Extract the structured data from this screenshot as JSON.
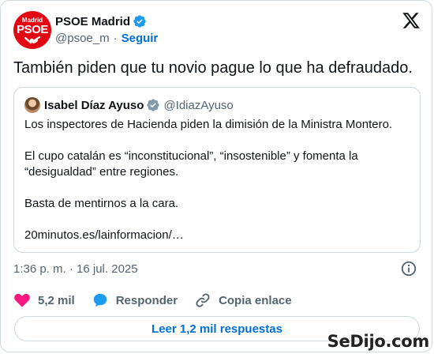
{
  "author": {
    "name": "PSOE Madrid",
    "handle": "@psoe_m",
    "separator": "·",
    "follow_label": "Seguir",
    "avatar_line1": "Madrid",
    "avatar_line2": "PSOE"
  },
  "tweet": {
    "text": "También piden que tu novio pague lo que ha defraudado."
  },
  "quoted": {
    "name": "Isabel Díaz Ayuso",
    "handle": "@IdiazAyuso",
    "paragraphs": [
      "Los inspectores de Hacienda piden la dimisión de la Ministra Montero.",
      "El cupo catalán es “inconstitucional”, “insostenible” y fomenta la “desigualdad” entre regiones.",
      "Basta de mentirnos a la cara.",
      "20minutos.es/lainformacion/…"
    ]
  },
  "meta": {
    "timestamp": "1:36 p. m. · 16 jul. 2025"
  },
  "actions": {
    "likes": "5,2 mil",
    "reply_label": "Responder",
    "copy_label": "Copia enlace"
  },
  "replies_button": "Leer 1,2 mil respuestas",
  "watermark": "SeDijo.com",
  "colors": {
    "brand_red": "#e30613",
    "link_blue": "#006fd6",
    "like_pink": "#f91880",
    "verified_blue": "#1d9bf0",
    "verified_gray": "#829aab"
  },
  "icons": [
    "verified-badge-icon",
    "x-logo-icon",
    "info-icon",
    "heart-icon",
    "reply-icon",
    "link-icon"
  ]
}
